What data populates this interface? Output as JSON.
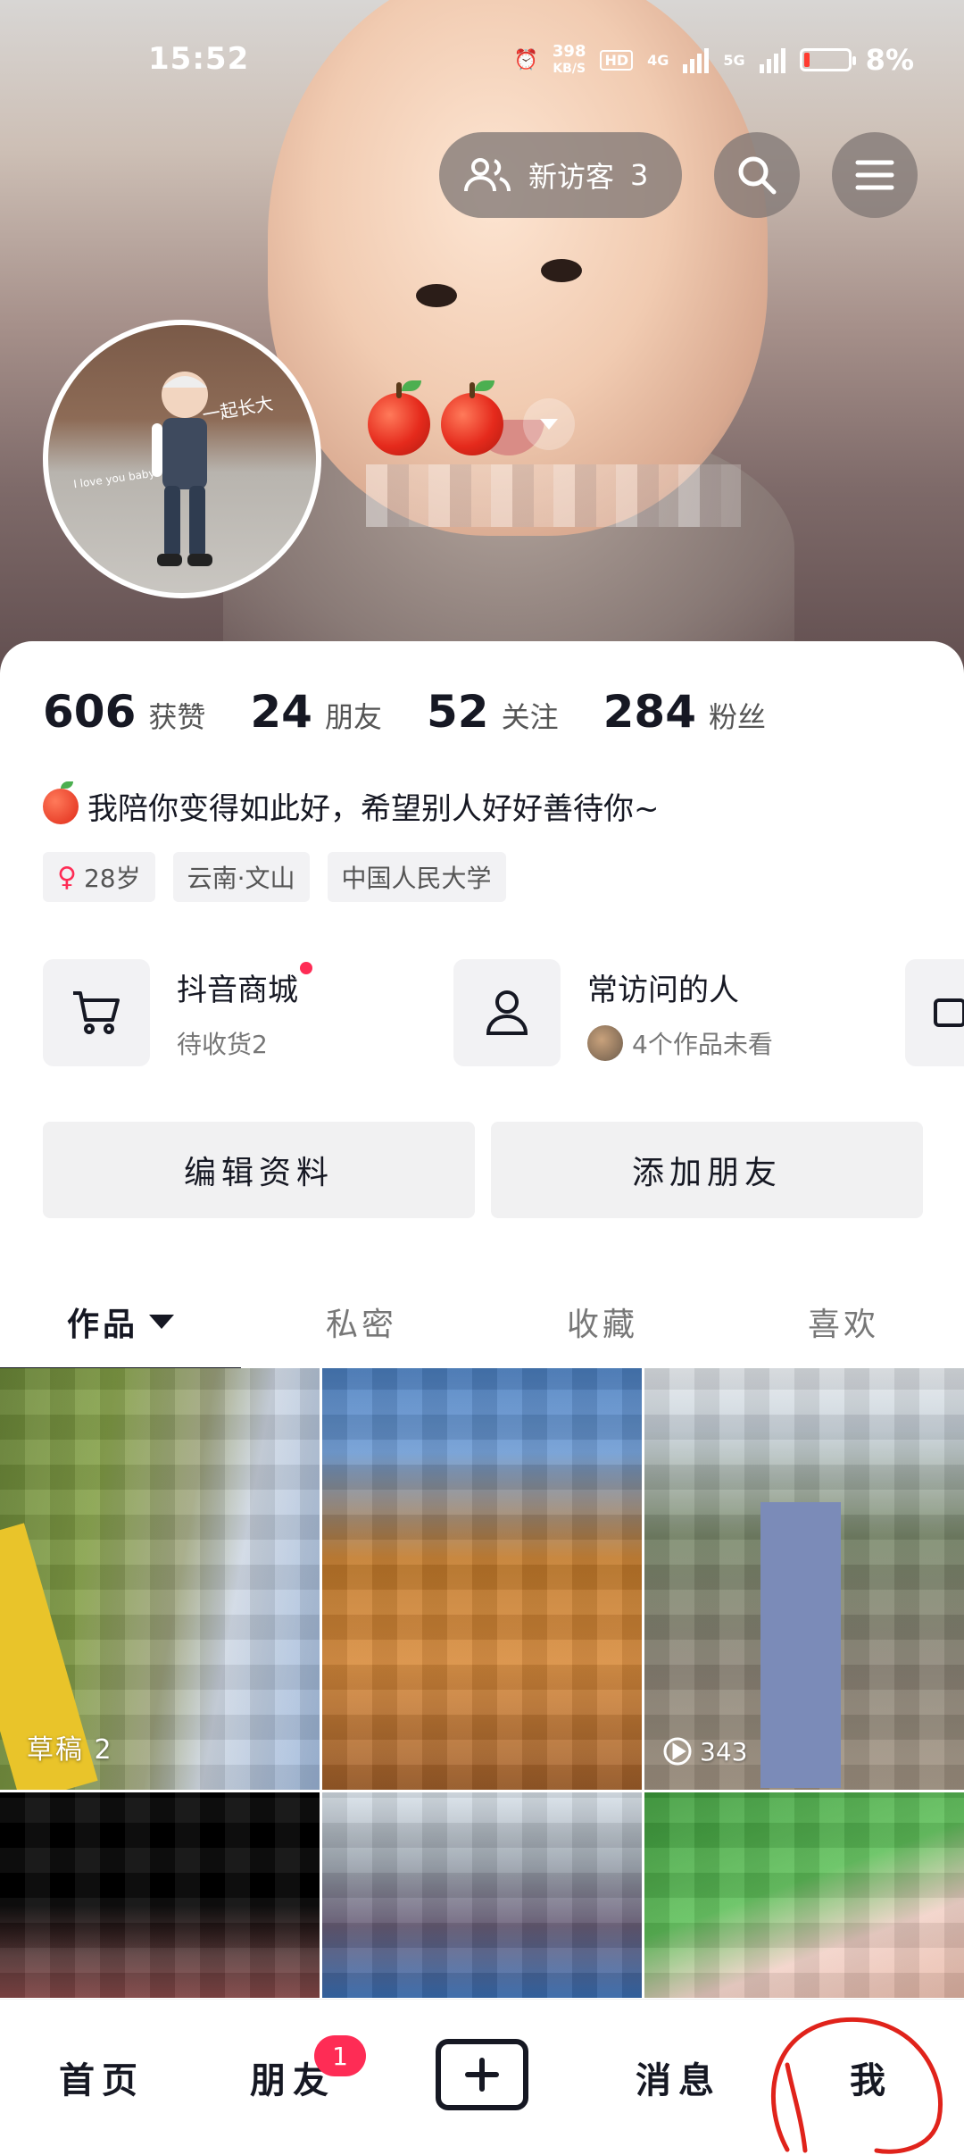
{
  "status_bar": {
    "time": "15:52",
    "net_speed_value": "398",
    "net_speed_unit": "KB/S",
    "hd": "HD",
    "sim1": "4G",
    "sim2": "5G",
    "battery": "8%"
  },
  "header": {
    "visitor_label": "新访客",
    "visitor_count": "3",
    "icons": [
      "visitors-icon",
      "search-icon",
      "menu-icon"
    ]
  },
  "profile": {
    "avatar_caption": "I love you baby",
    "avatar_banner": "一起长大",
    "name_emojis": [
      "🍎",
      "🍎"
    ],
    "stats": [
      {
        "num": "606",
        "label": "获赞"
      },
      {
        "num": "24",
        "label": "朋友"
      },
      {
        "num": "52",
        "label": "关注"
      },
      {
        "num": "284",
        "label": "粉丝"
      }
    ],
    "bio": "我陪你变得如此好，希望别人好好善待你~",
    "tags": [
      "28岁",
      "云南·文山",
      "中国人民大学"
    ]
  },
  "shortcuts": [
    {
      "title": "抖音商城",
      "sub": "待收货2"
    },
    {
      "title": "常访问的人",
      "sub": "4个作品未看"
    }
  ],
  "actions": {
    "edit": "编辑资料",
    "add_friend": "添加朋友"
  },
  "tabs": [
    "作品",
    "私密",
    "收藏",
    "喜欢"
  ],
  "grid": {
    "draft_label": "草稿 2",
    "play_count": "343"
  },
  "nav": {
    "home": "首页",
    "friends": "朋友",
    "friends_badge": "1",
    "messages": "消息",
    "me": "我"
  },
  "colors": {
    "accent": "#fe2c55",
    "text": "#161823",
    "annotation": "#e0231b"
  }
}
